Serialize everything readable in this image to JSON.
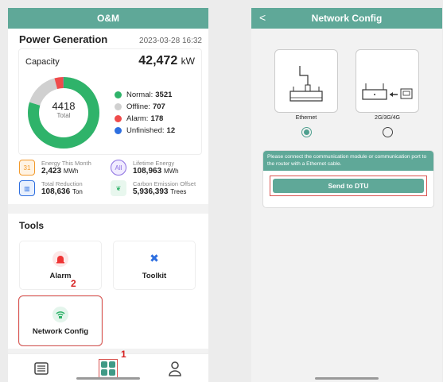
{
  "left": {
    "header_title": "O&M",
    "power_generation": {
      "title": "Power Generation",
      "timestamp": "2023-03-28 16:32",
      "capacity_label": "Capacity",
      "capacity_value": "42,472",
      "capacity_unit": "kW",
      "total_count": "4418",
      "total_label": "Total",
      "legend": [
        {
          "label": "Normal:",
          "value": "3521",
          "color": "#2fb36a"
        },
        {
          "label": "Offline:",
          "value": "707",
          "color": "#d0d0d0"
        },
        {
          "label": "Alarm:",
          "value": "178",
          "color": "#ef4b4b"
        },
        {
          "label": "Unfinished:",
          "value": "12",
          "color": "#2e6fe0"
        }
      ]
    },
    "stats": [
      {
        "label": "Energy This Month",
        "value": "2,423",
        "unit": "MWh",
        "icon": "calendar-icon",
        "glyph": "31"
      },
      {
        "label": "Lifetime Energy",
        "value": "108,963",
        "unit": "MWh",
        "icon": "all-icon",
        "glyph": "All"
      },
      {
        "label": "Total Reduction",
        "value": "108,636",
        "unit": "Ton",
        "icon": "factory-icon",
        "glyph": "▥"
      },
      {
        "label": "Carbon Emission Offset",
        "value": "5,936,393",
        "unit": "Trees",
        "icon": "tree-icon",
        "glyph": "❦"
      }
    ],
    "tools": {
      "title": "Tools",
      "alarm_label": "Alarm",
      "toolkit_label": "Toolkit",
      "network_label": "Network Config"
    },
    "annotations": {
      "one": "1",
      "two": "2"
    }
  },
  "right": {
    "header_title": "Network Config",
    "back_glyph": "<",
    "ethernet_label": "Ethernet",
    "cellular_label": "2G/3G/4G",
    "selected": "ethernet",
    "message": "Please connect the communication module or communication port to the router with a Ethernet cable.",
    "button_label": "Send to DTU"
  },
  "colors": {
    "accent": "#5fa898",
    "highlight": "#d9534f"
  }
}
